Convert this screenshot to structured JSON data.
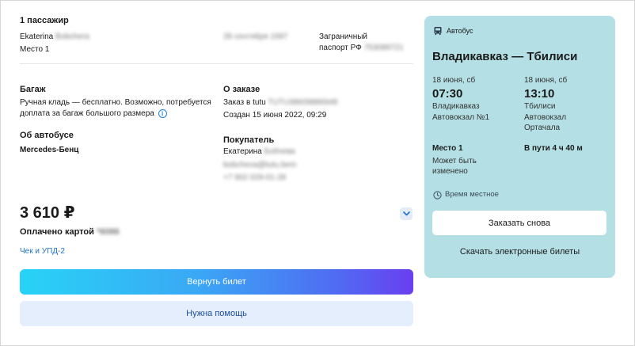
{
  "passenger": {
    "heading": "1 пассажир",
    "first_name": "Ekaterina",
    "last_name": "Bobchera",
    "seat": "Место 1",
    "birth_date": "28 сентября 1997",
    "document_label_line1": "Заграничный",
    "document_label_line2": "паспорт РФ",
    "document_number": "753089721"
  },
  "baggage": {
    "heading": "Багаж",
    "text_line1": "Ручная кладь — бесплатно. Возможно, потребуется",
    "text_line2": "доплата за багаж большого размера",
    "info_icon": "i"
  },
  "bus": {
    "heading": "Об автобусе",
    "model": "Mercedes-Бенц"
  },
  "order": {
    "heading": "О заказе",
    "number_label": "Заказ в tutu",
    "number_value": "TUTU38609886948",
    "created": "Создан 15 июня 2022, 09:29"
  },
  "buyer": {
    "heading": "Покупатель",
    "first_name": "Екатерина",
    "last_name": "Бобчева",
    "email": "bobcheva@tutu.bem",
    "phone": "+7 902 029-01-28"
  },
  "payment": {
    "price": "3 610 ₽",
    "paid_label": "Оплачено картой",
    "card_mask": "*6086",
    "receipt_link": "Чек и УПД-2"
  },
  "buttons": {
    "refund": "Вернуть билет",
    "help": "Нужна помощь"
  },
  "trip": {
    "transport_type": "Автобус",
    "route": "Владикавказ — Тбилиси",
    "departure": {
      "date": "18 июня, сб",
      "time": "07:30",
      "city": "Владикавказ",
      "station": "Автовокзал №1"
    },
    "arrival": {
      "date": "18 июня, сб",
      "time": "13:10",
      "city": "Тбилиси",
      "station_line1": "Автовокзал",
      "station_line2": "Ортачала"
    },
    "seat": "Место 1",
    "seat_note_line1": "Может быть",
    "seat_note_line2": "изменено",
    "duration": "В пути 4 ч 40 м",
    "time_note": "Время местное",
    "reorder_button": "Заказать снова",
    "download_link": "Скачать электронные билеты"
  },
  "colors": {
    "card_background": "#b4e0e5",
    "link": "#1e73c8",
    "help_button_background": "#e4eefc"
  }
}
